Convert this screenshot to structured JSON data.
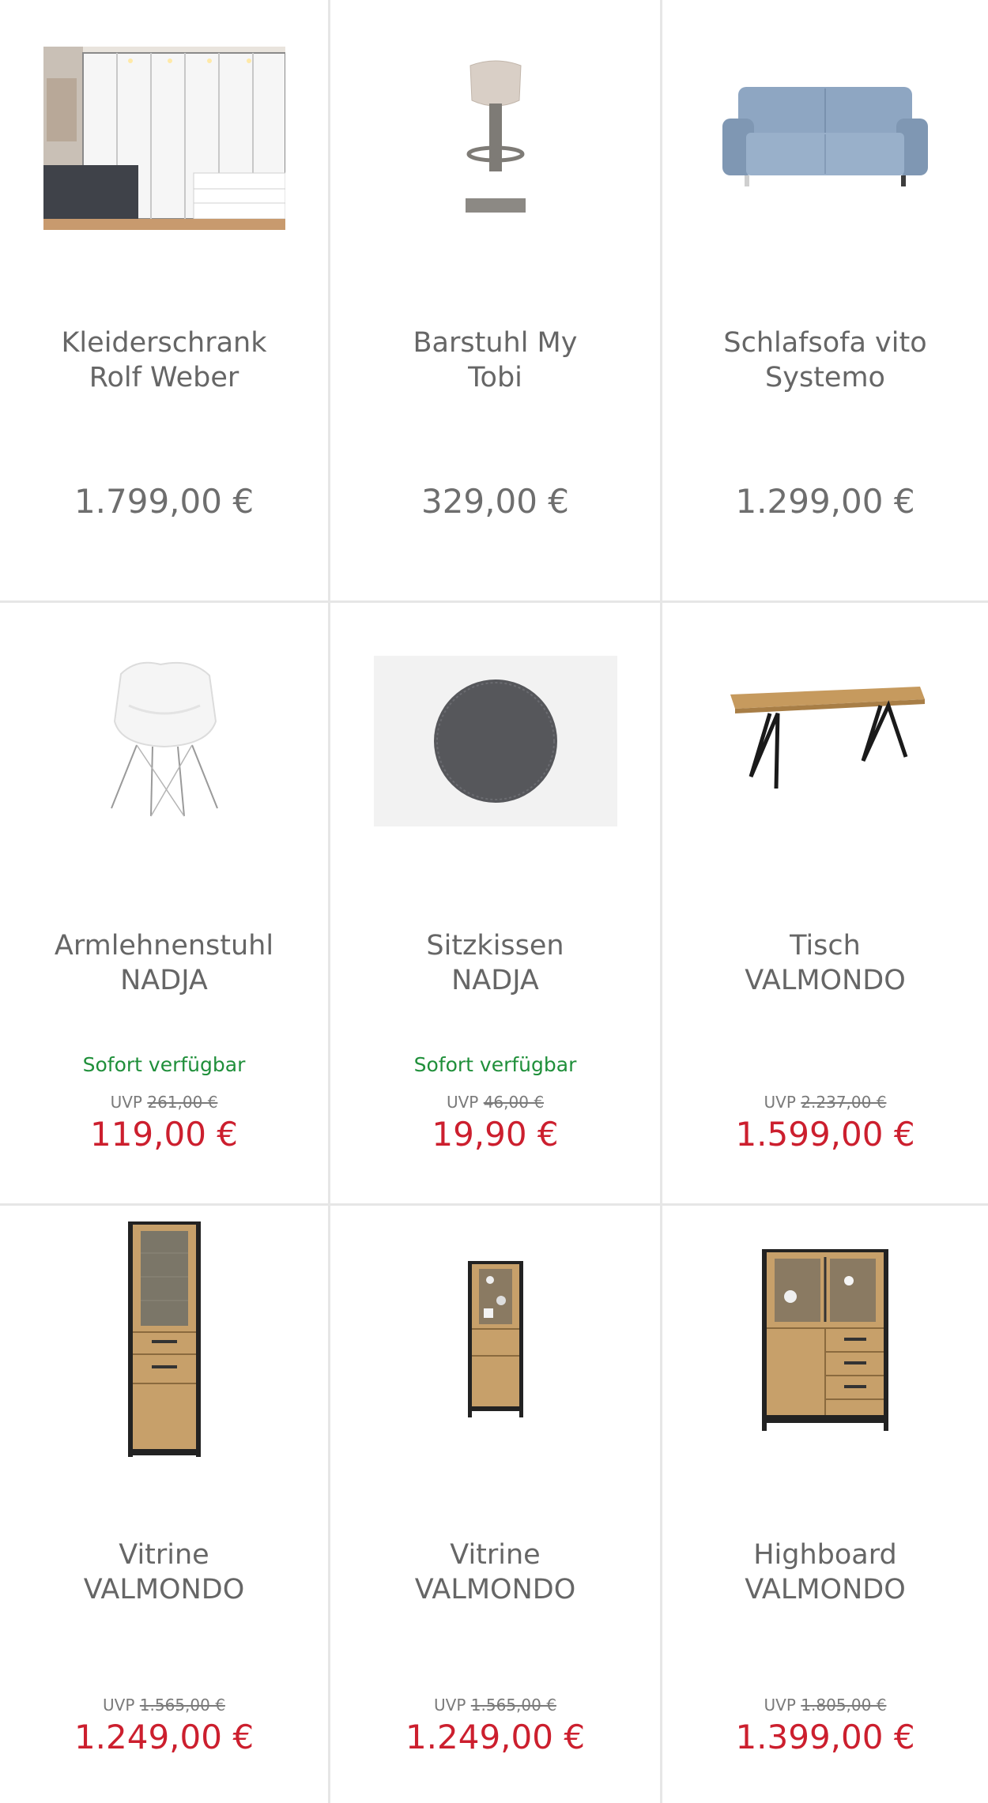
{
  "products": [
    {
      "name_line1": "Kleiderschrank",
      "name_line2": "Rolf Weber",
      "price": "1.799,00 €"
    },
    {
      "name_line1": "Barstuhl My",
      "name_line2": "Tobi",
      "price": "329,00 €"
    },
    {
      "name_line1": "Schlafsofa vito",
      "name_line2": "Systemo",
      "price": "1.299,00 €"
    },
    {
      "name_line1": "Armlehnenstuhl",
      "name_line2": "NADJA",
      "availability": "Sofort verfügbar",
      "uvp_label": "UVP",
      "uvp_price": "261,00 €",
      "price": "119,00 €"
    },
    {
      "name_line1": "Sitzkissen",
      "name_line2": "NADJA",
      "availability": "Sofort verfügbar",
      "uvp_label": "UVP",
      "uvp_price": "46,00 €",
      "price": "19,90 €"
    },
    {
      "name_line1": "Tisch",
      "name_line2": "VALMONDO",
      "uvp_label": "UVP",
      "uvp_price": "2.237,00 €",
      "price": "1.599,00 €"
    },
    {
      "name_line1": "Vitrine",
      "name_line2": "VALMONDO",
      "uvp_label": "UVP",
      "uvp_price": "1.565,00 €",
      "price": "1.249,00 €"
    },
    {
      "name_line1": "Vitrine",
      "name_line2": "VALMONDO",
      "uvp_label": "UVP",
      "uvp_price": "1.565,00 €",
      "price": "1.249,00 €"
    },
    {
      "name_line1": "Highboard",
      "name_line2": "VALMONDO",
      "uvp_label": "UVP",
      "uvp_price": "1.805,00 €",
      "price": "1.399,00 €"
    }
  ],
  "colors": {
    "sale_price": "#cc1f2e",
    "regular_price": "#6e6e6e",
    "availability": "#1f8f3a",
    "divider": "#e6e6e6"
  }
}
